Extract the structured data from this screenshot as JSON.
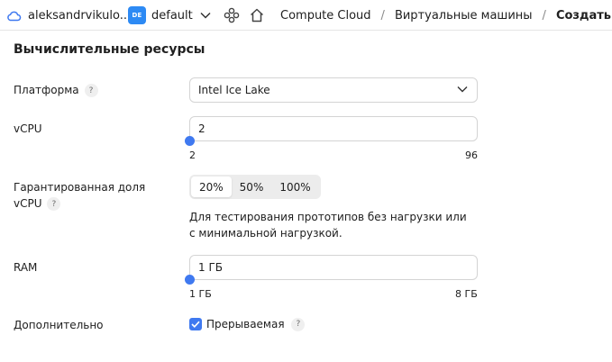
{
  "topbar": {
    "account": "aleksandrvikulo...",
    "folder_badge": "DE",
    "folder": "default",
    "breadcrumbs": [
      "Compute Cloud",
      "Виртуальные машины",
      "Создать"
    ],
    "separator": "/"
  },
  "section": {
    "title": "Вычислительные ресурсы"
  },
  "platform": {
    "label": "Платформа",
    "help": "?",
    "value": "Intel Ice Lake"
  },
  "vcpu": {
    "label": "vCPU",
    "value": "2",
    "min_label": "2",
    "max_label": "96",
    "min": 2,
    "max": 96,
    "current": 2
  },
  "fraction": {
    "label_line1": "Гарантированная доля",
    "label_line2": "vCPU",
    "help": "?",
    "options": [
      "20%",
      "50%",
      "100%"
    ],
    "selected": "20%",
    "hint_line1": "Для тестирования прототипов без нагрузки или",
    "hint_line2": "с минимальной нагрузкой."
  },
  "ram": {
    "label": "RAM",
    "value": "1 ГБ",
    "min_label": "1 ГБ",
    "max_label": "8 ГБ",
    "min": 1,
    "max": 8,
    "current": 1
  },
  "extra": {
    "label": "Дополнительно",
    "preemptible_label": "Прерываемая",
    "preemptible_checked": true,
    "help": "?"
  },
  "colors": {
    "accent": "#3f79f0",
    "badge": "#2d8af4"
  },
  "icons": [
    "cloud-icon",
    "chevron-down-icon",
    "services-icon",
    "home-icon",
    "help-icon",
    "checkmark-icon"
  ]
}
